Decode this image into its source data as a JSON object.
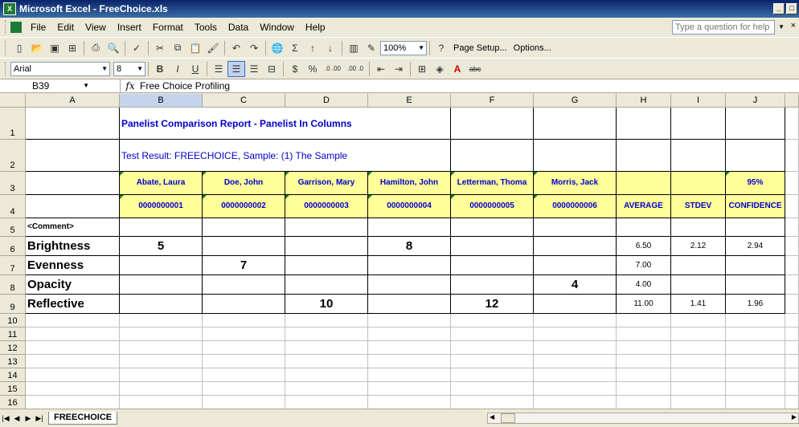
{
  "window": {
    "title": "Microsoft Excel - FreeChoice.xls"
  },
  "menu": [
    "File",
    "Edit",
    "View",
    "Insert",
    "Format",
    "Tools",
    "Data",
    "Window",
    "Help"
  ],
  "ask_placeholder": "Type a question for help",
  "toolbar": {
    "zoom": "100%",
    "page_setup": "Page Setup...",
    "options": "Options..."
  },
  "format": {
    "font": "Arial",
    "size": "8",
    "bold": "B",
    "italic": "I",
    "underline": "U",
    "currency": "$",
    "percent": "%",
    "inc_dec": ".0 .00",
    "dec_dec": ".00 .0"
  },
  "formula_bar": {
    "cell_ref": "B39",
    "fx": "fx",
    "value": "Free Choice Profiling"
  },
  "columns": [
    "A",
    "B",
    "C",
    "D",
    "E",
    "F",
    "G",
    "H",
    "I",
    "J"
  ],
  "rows": [
    "1",
    "2",
    "3",
    "4",
    "5",
    "6",
    "7",
    "8",
    "9",
    "10",
    "11",
    "12",
    "13",
    "14",
    "15",
    "16"
  ],
  "report": {
    "title": "Panelist Comparison Report - Panelist In Columns",
    "test_result": "Test Result:  FREECHOICE,   Sample: (1) The Sample",
    "panelists": [
      "Abate, Laura",
      "Doe, John",
      "Garrison, Mary",
      "Hamilton, John",
      "Letterman, Thoma",
      "Morris, Jack"
    ],
    "ids": [
      "0000000001",
      "0000000002",
      "0000000003",
      "0000000004",
      "0000000005",
      "0000000006"
    ],
    "confidence_level": "95%",
    "stat_headers": [
      "AVERAGE",
      "STDEV",
      "CONFIDENCE"
    ],
    "comment": "<Comment>",
    "attributes": [
      {
        "name": "Brightness",
        "scores": [
          "5",
          "",
          "",
          "8",
          "",
          ""
        ],
        "average": "6.50",
        "stdev": "2.12",
        "confidence": "2.94"
      },
      {
        "name": "Evenness",
        "scores": [
          "",
          "7",
          "",
          "",
          "",
          ""
        ],
        "average": "7.00",
        "stdev": "",
        "confidence": ""
      },
      {
        "name": "Opacity",
        "scores": [
          "",
          "",
          "",
          "",
          "",
          "4"
        ],
        "average": "4.00",
        "stdev": "",
        "confidence": ""
      },
      {
        "name": "Reflective",
        "scores": [
          "",
          "",
          "10",
          "",
          "12",
          ""
        ],
        "average": "11.00",
        "stdev": "1.41",
        "confidence": "1.96"
      }
    ]
  },
  "sheet_tab": "FREECHOICE"
}
